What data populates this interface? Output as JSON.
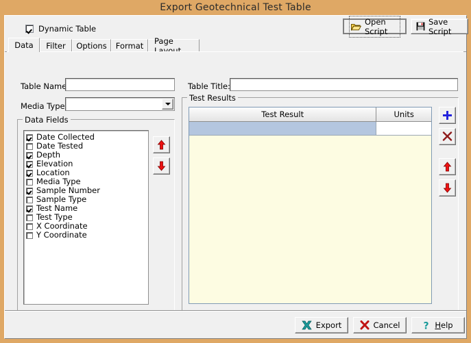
{
  "window": {
    "title": "Export Geotechnical Test Table",
    "border_color": "#dfa865",
    "face_color": "#f0f0f0"
  },
  "toolbar": {
    "dynamic_table_label": "Dynamic Table",
    "dynamic_table_checked": true,
    "open_script_label": "Open Script",
    "save_script_label": "Save Script"
  },
  "tabs": [
    {
      "label": "Data",
      "active": true
    },
    {
      "label": "Filter",
      "active": false
    },
    {
      "label": "Options",
      "active": false
    },
    {
      "label": "Format",
      "active": false
    },
    {
      "label": "Page Layout",
      "active": false
    }
  ],
  "form": {
    "table_name_label": "Table Name:",
    "table_name_value": "",
    "table_name_placeholder": "",
    "media_type_label": "Media Type:",
    "media_type_value": "",
    "table_title_label": "Table Title:",
    "table_title_value": "",
    "table_title_placeholder": ""
  },
  "data_fields": {
    "group_title": "Data Fields",
    "items": [
      {
        "label": "Date Collected",
        "checked": true
      },
      {
        "label": "Date Tested",
        "checked": false
      },
      {
        "label": "Depth",
        "checked": true
      },
      {
        "label": "Elevation",
        "checked": true
      },
      {
        "label": "Location",
        "checked": true
      },
      {
        "label": "Media Type",
        "checked": false
      },
      {
        "label": "Sample Number",
        "checked": true
      },
      {
        "label": "Sample Type",
        "checked": false
      },
      {
        "label": "Test Name",
        "checked": true
      },
      {
        "label": "Test Type",
        "checked": false
      },
      {
        "label": "X Coordinate",
        "checked": false
      },
      {
        "label": "Y Coordinate",
        "checked": false
      }
    ],
    "move_up_title": "Move Up",
    "move_down_title": "Move Down"
  },
  "test_results": {
    "group_title": "Test Results",
    "columns": [
      "Test Result",
      "Units"
    ],
    "rows": [
      {
        "test_result": "",
        "units": "",
        "selected": true
      }
    ],
    "add_title": "Add",
    "delete_title": "Delete",
    "move_up_title": "Move Up",
    "move_down_title": "Move Down",
    "grid_background": "#fdfce2",
    "selection_color": "#b4c6df"
  },
  "footer": {
    "export_label": "Export",
    "cancel_label": "Cancel",
    "help_label_prefix": "H",
    "help_label_rest": "elp"
  }
}
